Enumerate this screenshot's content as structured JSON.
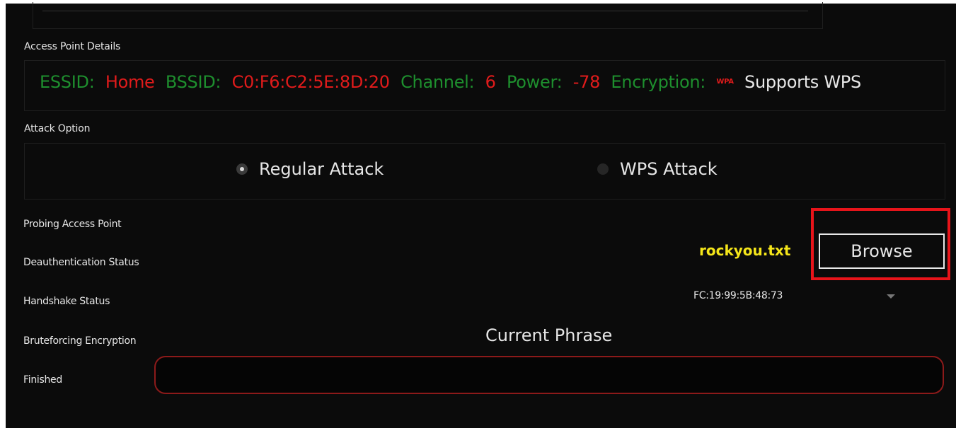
{
  "access_point": {
    "group_label": "Access Point Details",
    "essid_label": "ESSID:",
    "essid_value": "Home",
    "bssid_label": "BSSID:",
    "bssid_value": "C0:F6:C2:5E:8D:20",
    "channel_label": "Channel:",
    "channel_value": "6",
    "power_label": "Power:",
    "power_value": "-78",
    "encryption_label": "Encryption:",
    "encryption_value": "WPA",
    "wps_support": "Supports WPS"
  },
  "attack_option": {
    "group_label": "Attack Option",
    "options": [
      {
        "label": "Regular Attack",
        "selected": true
      },
      {
        "label": "WPS Attack",
        "selected": false
      }
    ]
  },
  "status": {
    "items": [
      "Probing Access Point",
      "Deauthentication Status",
      "Handshake Status",
      "Bruteforcing Encryption",
      "Finished"
    ]
  },
  "wordlist": {
    "filename": "rockyou.txt",
    "browse_label": "Browse"
  },
  "mac_select": {
    "value": "FC:19:99:5B:48:73"
  },
  "current_phrase": {
    "label": "Current Phrase",
    "value": ""
  },
  "colors": {
    "label_green": "#1e8f2e",
    "value_red": "#e01b1b",
    "wordlist_yellow": "#f5e61a",
    "highlight_red": "#e8141a"
  }
}
